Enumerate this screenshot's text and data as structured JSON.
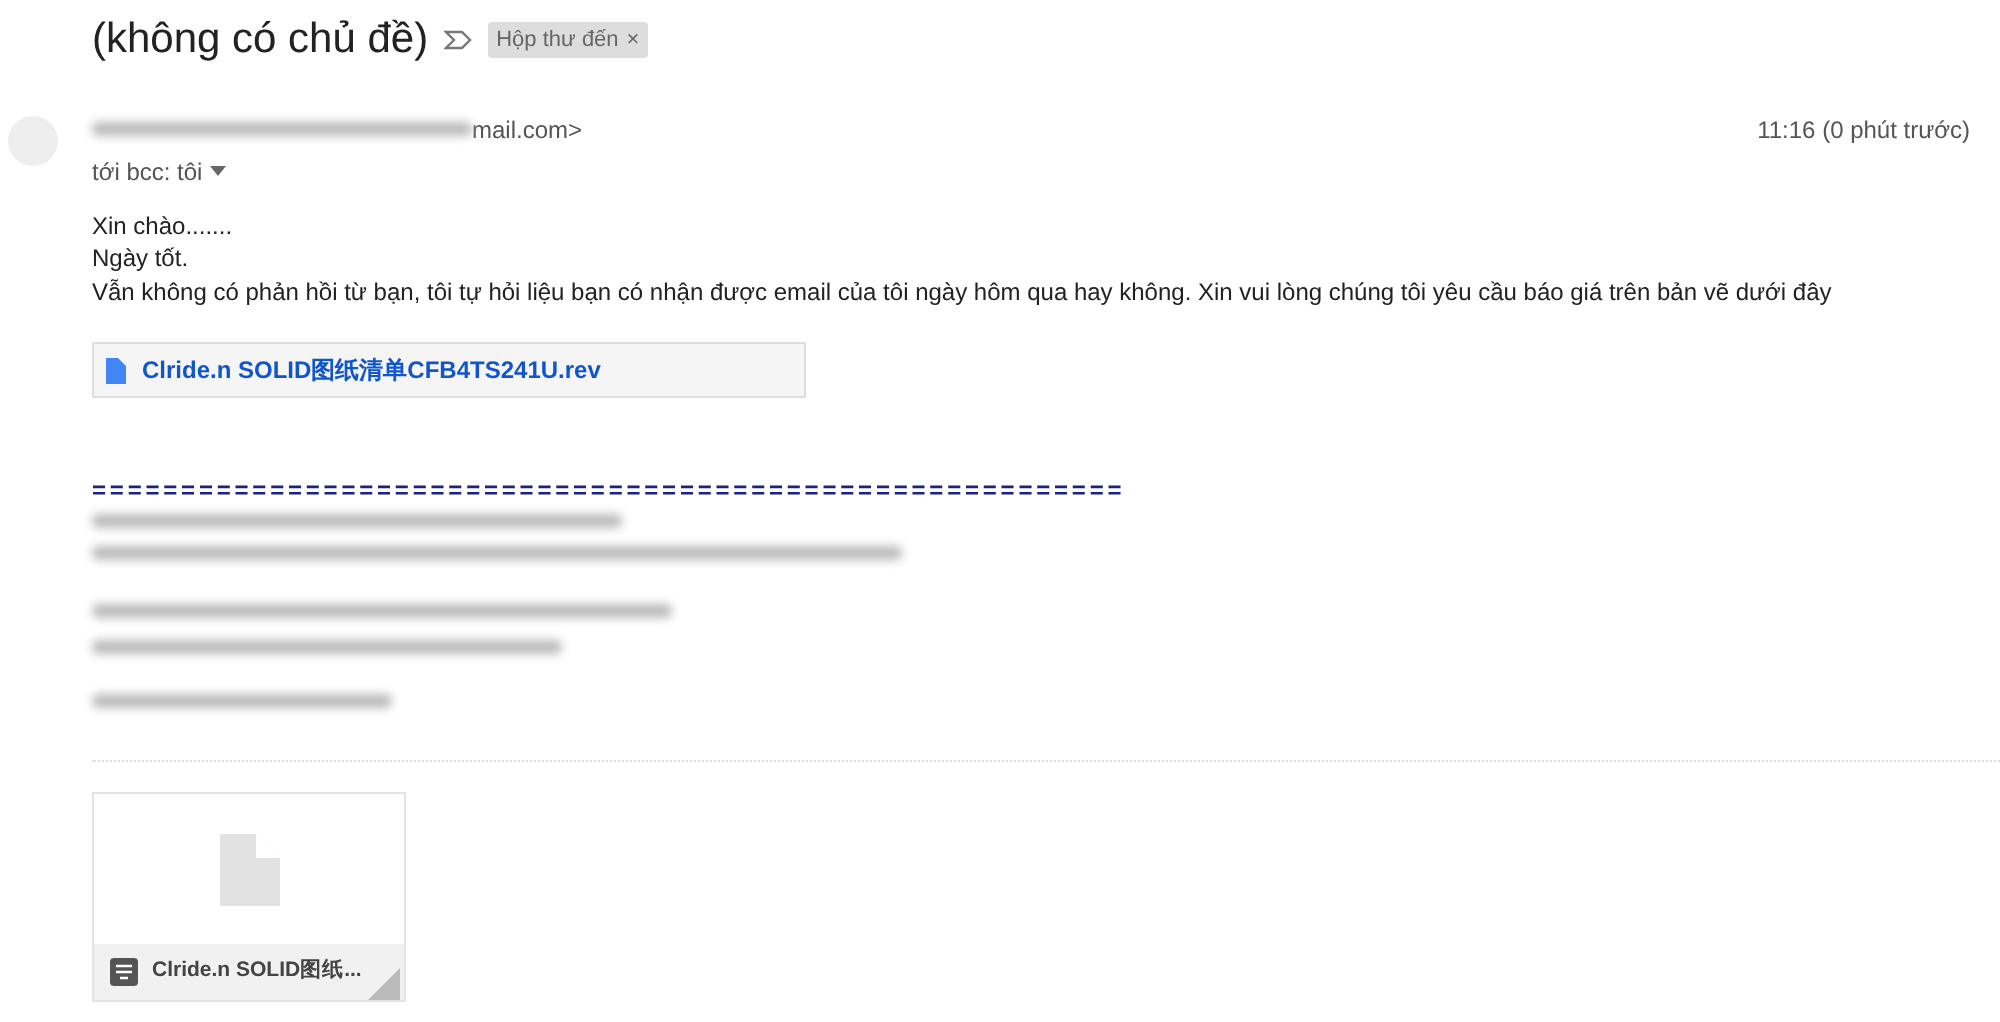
{
  "subject": "(không có chủ đề)",
  "label": {
    "text": "Hộp thư đến",
    "close": "×"
  },
  "sender": {
    "visible_tail": "mail.com>",
    "recipient": "tới bcc: tôi",
    "time": "11:16 (0 phút trước)"
  },
  "body": [
    "Xin chào.......",
    "Ngày tốt.",
    "Vẫn không có phản hồi từ bạn, tôi tự hỏi liệu bạn có nhận được email của tôi ngày hôm qua hay không. Xin vui lòng chúng tôi yêu cầu báo giá trên bản vẽ dưới đây"
  ],
  "inline_attachment": "Clride.n SOLID图纸清单CFB4TS241U.rev",
  "signature_rule": "==========================================================",
  "attachment_card": {
    "name": "Clride.n SOLID图纸..."
  }
}
